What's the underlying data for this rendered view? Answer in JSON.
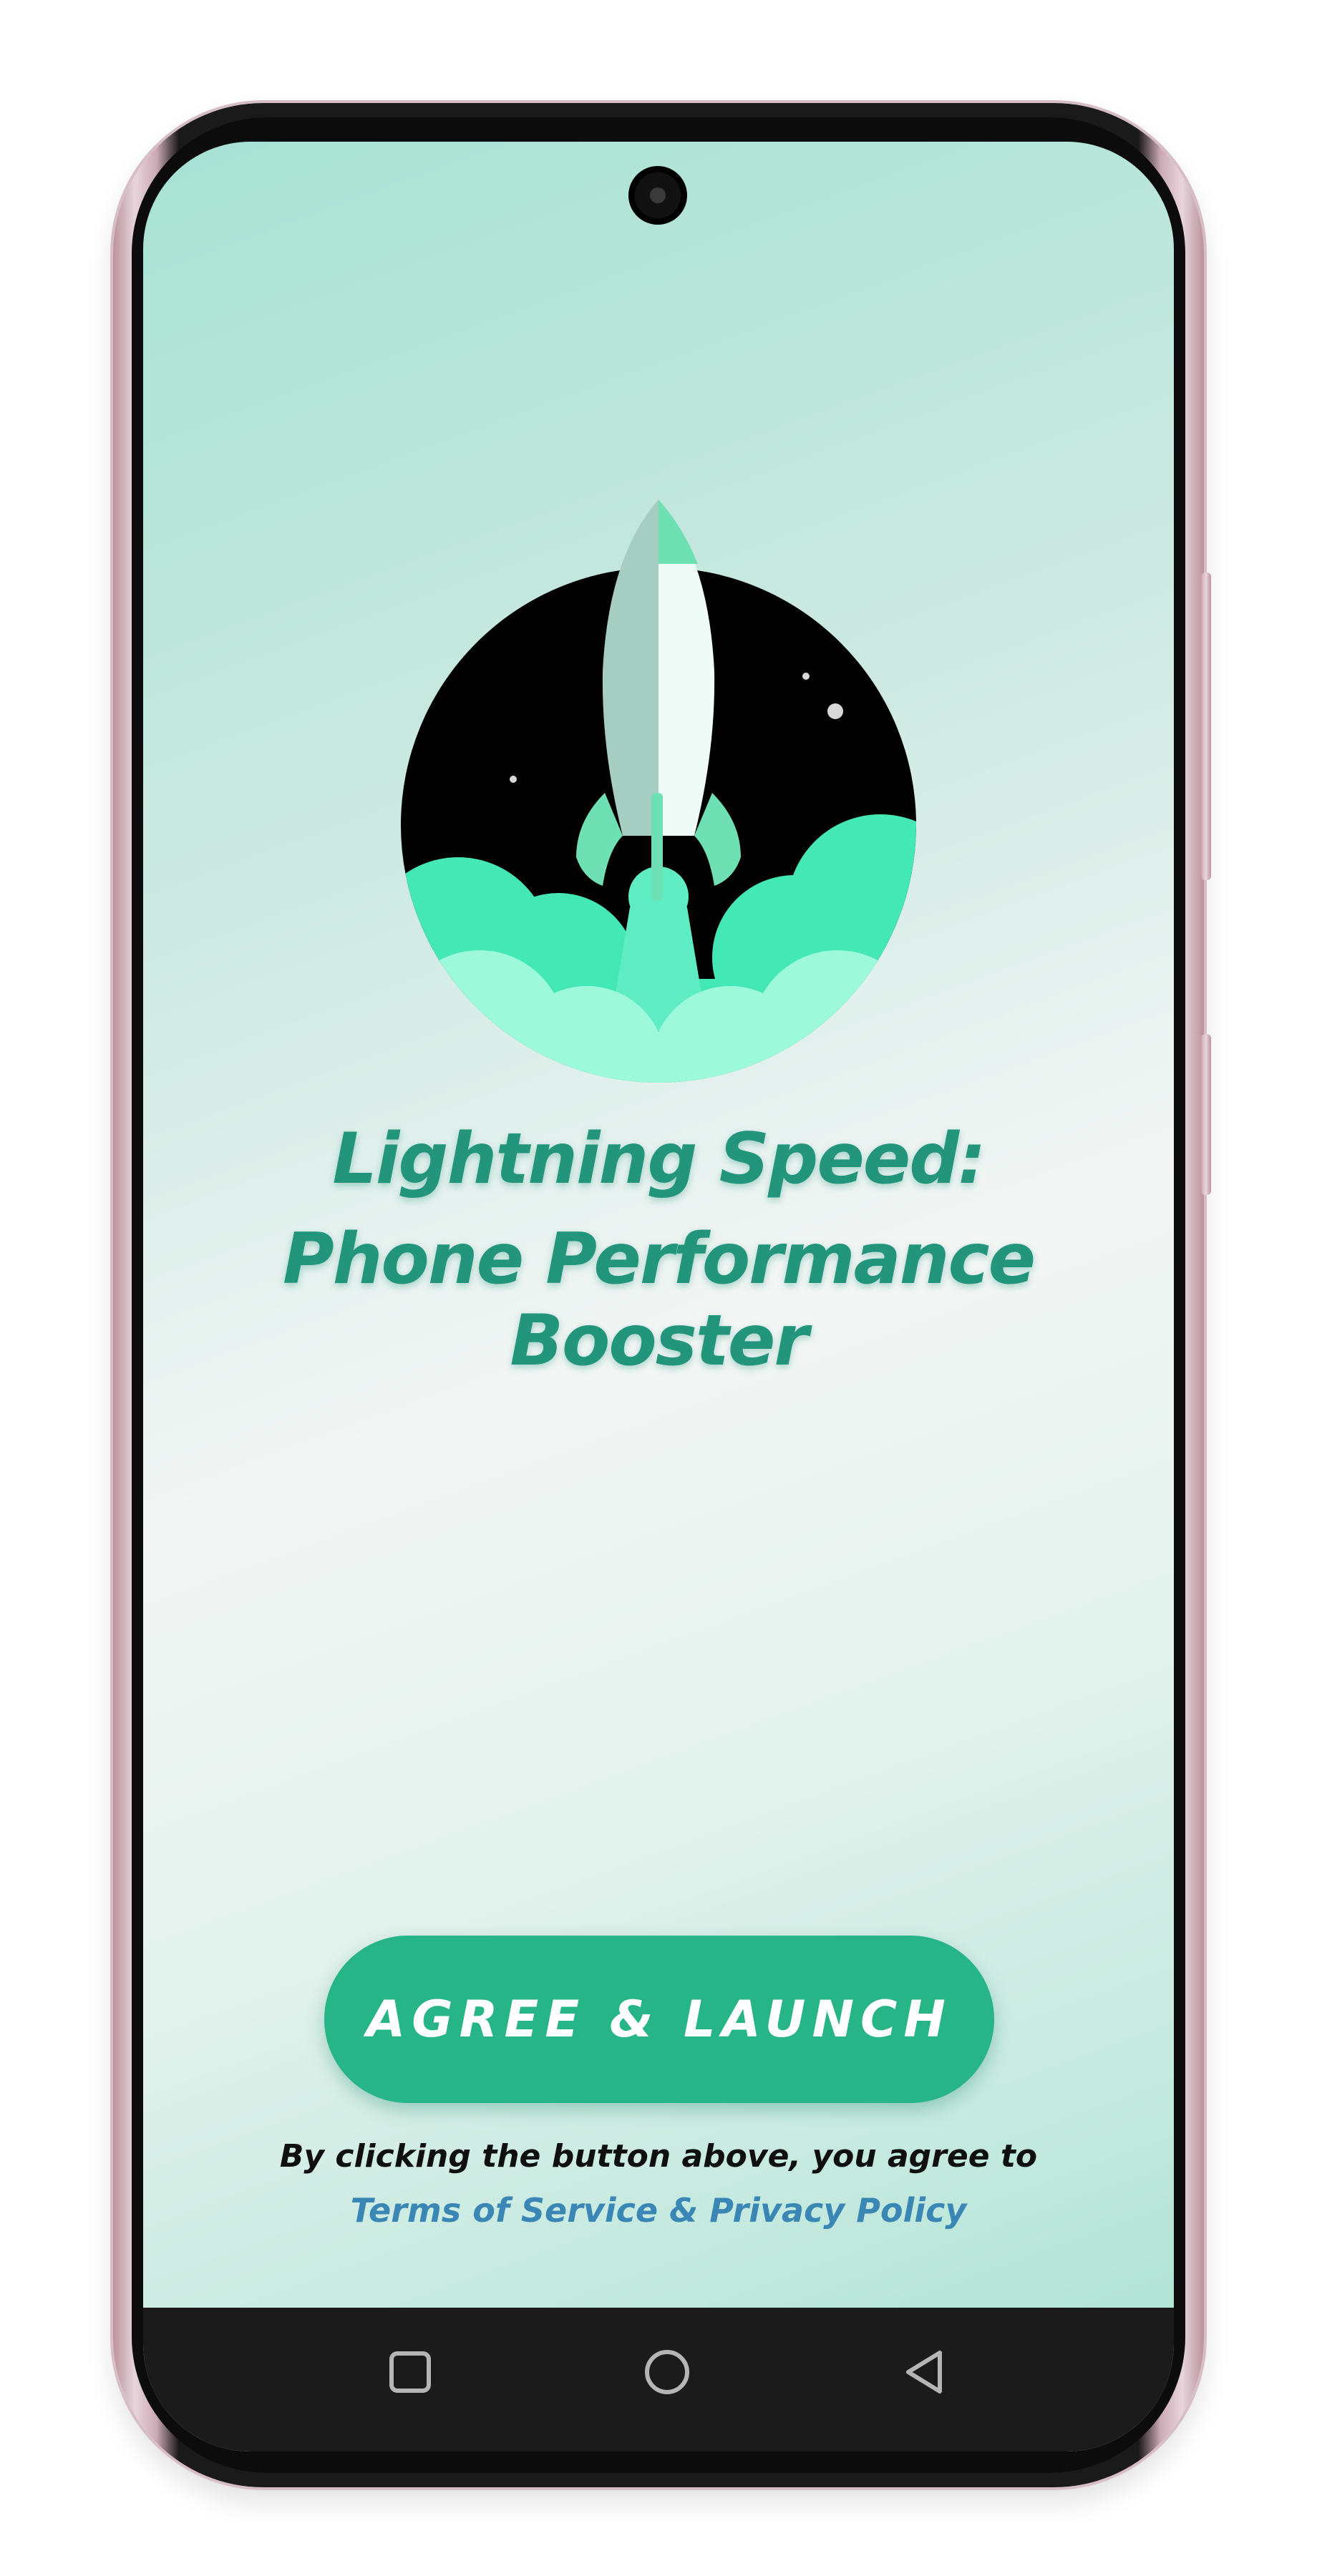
{
  "screen": {
    "headline_line1": "Lightning Speed:",
    "headline_line2": "Phone Performance Booster"
  },
  "cta": {
    "label": "AGREE & LAUNCH"
  },
  "consent": {
    "text": "By clicking the button above, you agree to",
    "link_label": "Terms of Service & Privacy Policy"
  },
  "nav_bar": {
    "recents_icon": "square-recents-icon",
    "home_icon": "circle-home-icon",
    "back_icon": "triangle-back-icon"
  },
  "colors": {
    "accent": "#27b486",
    "headline": "#23957b",
    "link": "#3a87b5",
    "background_top": "#a7e2d3",
    "nav_bar": "#1b1b1b"
  }
}
